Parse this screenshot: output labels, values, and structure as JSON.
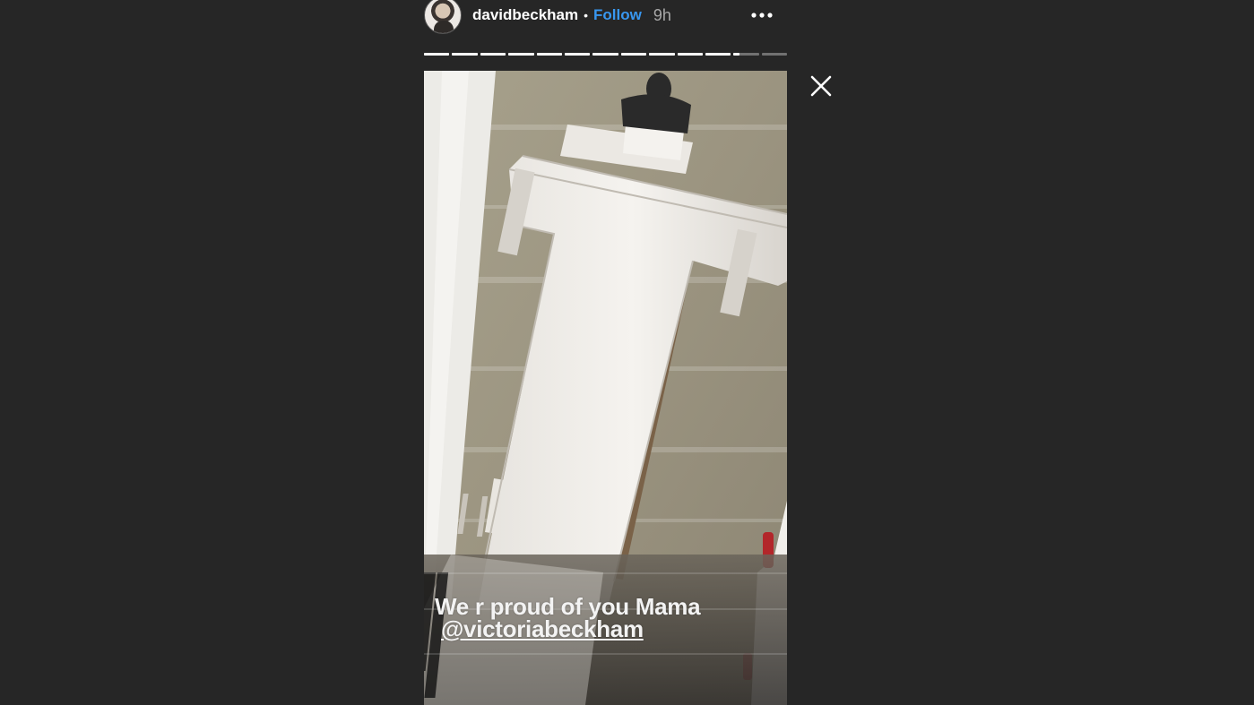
{
  "story": {
    "username": "davidbeckham",
    "separator": "•",
    "follow_label": "Follow",
    "time_ago": "9h",
    "avatar_icon": "avatar-photo",
    "more_icon": "more-options-icon",
    "close_icon": "close-icon",
    "progress": {
      "segments_total": 13,
      "segments_completed": 11,
      "current_segment_fraction": 0.25
    },
    "caption": {
      "line1": "We r proud of you Mama",
      "mention": "@victoriabeckham"
    }
  },
  "colors": {
    "background": "#262626",
    "follow": "#3897f0",
    "time": "#a8a8a8",
    "text": "#ffffff"
  }
}
